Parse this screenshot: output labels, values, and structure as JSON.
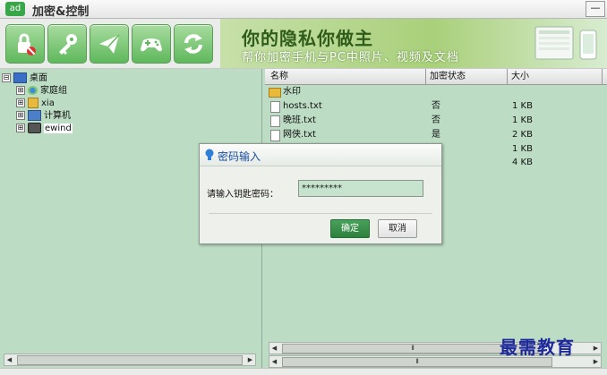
{
  "window": {
    "logo": "ad",
    "title": "加密&控制",
    "minimize_symbol": "—"
  },
  "toolbar": {
    "buttons": [
      {
        "name": "lock-icon",
        "label": ""
      },
      {
        "name": "key-icon",
        "label": ""
      },
      {
        "name": "send-icon",
        "label": ""
      },
      {
        "name": "gamepad-icon",
        "label": ""
      },
      {
        "name": "refresh-icon",
        "label": ""
      }
    ]
  },
  "banner": {
    "title": "你的隐私你做主",
    "subtitle": "帮你加密手机与PC中照片、视频及文档"
  },
  "tree": {
    "root": {
      "expander": "⊟",
      "label": "桌面"
    },
    "children": [
      {
        "expander": "⊞",
        "label": "家庭组"
      },
      {
        "expander": "⊞",
        "label": "xia"
      },
      {
        "expander": "⊞",
        "label": "计算机"
      },
      {
        "expander": "⊞",
        "label": "ewind"
      }
    ]
  },
  "file_list": {
    "columns": {
      "name": "名称",
      "state": "加密状态",
      "size": "大小"
    },
    "rows": [
      {
        "name": "水印",
        "state": "",
        "size": "",
        "type": "folder"
      },
      {
        "name": "hosts.txt",
        "state": "否",
        "size": "1 KB",
        "type": "file"
      },
      {
        "name": "晚班.txt",
        "state": "否",
        "size": "1 KB",
        "type": "file"
      },
      {
        "name": "网侠.txt",
        "state": "是",
        "size": "2 KB",
        "type": "file"
      },
      {
        "name": "",
        "state": "",
        "size": "1 KB",
        "type": "file"
      },
      {
        "name": "",
        "state": "",
        "size": "4 KB",
        "type": "file"
      }
    ]
  },
  "scrollbar": {
    "left_arrow": "◀",
    "right_arrow": "▶",
    "grip": "⦀"
  },
  "dialog": {
    "title": "密码输入",
    "password_label": "请输入钥匙密码：",
    "password_value": "*********",
    "ok_label": "确定",
    "cancel_label": "取消"
  },
  "watermark": "最需教育",
  "colors": {
    "accent": "#3aa64a",
    "panel_bg": "#bcdcc4",
    "dialog_title": "#1a4fa0"
  }
}
